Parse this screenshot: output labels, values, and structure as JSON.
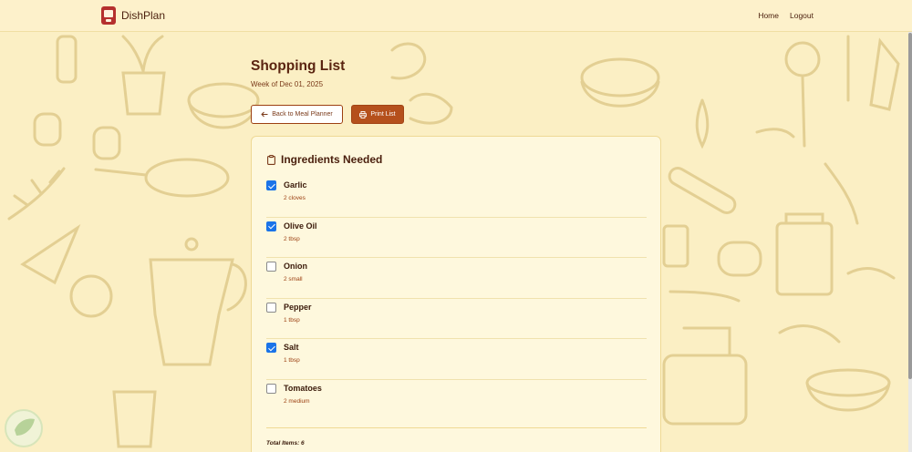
{
  "nav": {
    "brand": "DishPlan",
    "links": {
      "home": "Home",
      "logout": "Logout"
    }
  },
  "header": {
    "title": "Shopping List",
    "subtitle": "Week of Dec 01, 2025"
  },
  "buttons": {
    "back": "Back to Meal Planner",
    "print": "Print List"
  },
  "card": {
    "title": "Ingredients Needed",
    "items": [
      {
        "name": "Garlic",
        "qty": "2 cloves",
        "checked": true
      },
      {
        "name": "Olive Oil",
        "qty": "2 tbsp",
        "checked": true
      },
      {
        "name": "Onion",
        "qty": "2 small",
        "checked": false
      },
      {
        "name": "Pepper",
        "qty": "1 tbsp",
        "checked": false
      },
      {
        "name": "Salt",
        "qty": "1 tbsp",
        "checked": true
      },
      {
        "name": "Tomatoes",
        "qty": "2 medium",
        "checked": false
      }
    ],
    "total": "Total Items: 6"
  },
  "icons": {
    "brand": "recipe-book-icon",
    "back": "arrow-left-icon",
    "print": "printer-icon",
    "card": "clipboard-icon"
  },
  "colors": {
    "background": "#fbefc4",
    "accent": "#b5501c",
    "checkbox": "#1a73e8",
    "brand_logo": "#b5302e"
  }
}
